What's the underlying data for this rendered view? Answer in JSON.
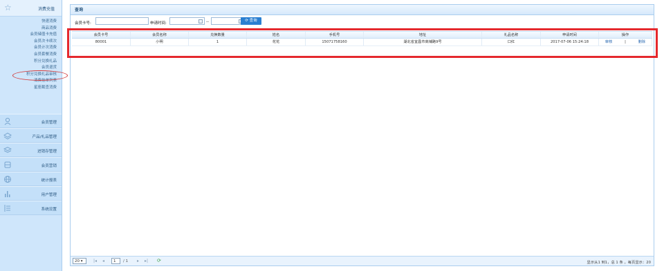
{
  "sidebar": {
    "top_group": "消费充值",
    "sub_items": [
      "快速消费",
      "商品消费",
      "会员储值卡充值",
      "会员次卡续次",
      "会员计次消费",
      "会员套餐消费",
      "积分兑换礼品",
      "会员退货",
      "积分兑换礼品审核",
      "消费挂单列表",
      "星座截查消费"
    ],
    "groups": [
      {
        "label": "会员管理",
        "icon": "person-icon"
      },
      {
        "label": "产品/礼品管理",
        "icon": "layers-icon"
      },
      {
        "label": "进销存管理",
        "icon": "stack-icon"
      },
      {
        "label": "会员营销",
        "icon": "database-icon"
      },
      {
        "label": "统计报表",
        "icon": "globe-icon"
      },
      {
        "label": "用户管理",
        "icon": "bar-chart-icon"
      },
      {
        "label": "系统设置",
        "icon": "list-icon"
      }
    ]
  },
  "panel": {
    "title": "查询"
  },
  "search": {
    "card_label": "会员卡号:",
    "date_label": "申请时间:",
    "date_sep": "--",
    "query_button": "查询",
    "card_value": "",
    "date_start": "",
    "date_end": ""
  },
  "table": {
    "columns": [
      "会员卡号",
      "会员名称",
      "兑换数量",
      "姓名",
      "手机号",
      "地址",
      "礼品名称",
      "申请时间",
      "操作"
    ],
    "rows": [
      {
        "card": "80001",
        "member": "小明",
        "qty": "1",
        "name": "花花",
        "phone": "15071758160",
        "address": "湖北省宜昌市高铺路9号",
        "gift": "口红",
        "time": "2017-07-06 15:24:18",
        "op_review": "审核",
        "op_delete": "删除",
        "op_sep": "|"
      }
    ]
  },
  "pager": {
    "page_size": "20",
    "current_page": "1",
    "total_pages": "/ 1",
    "info": "显示从1 到1，总 1 条 。每页显示：20"
  }
}
